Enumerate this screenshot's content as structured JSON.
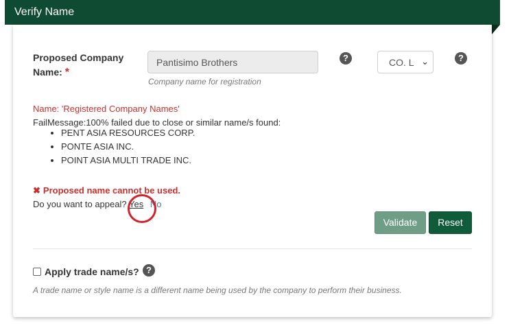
{
  "header": {
    "title": "Verify Name"
  },
  "form": {
    "label": "Proposed Company Name:",
    "required_mark": "*",
    "name_value": "Pantisimo Brothers",
    "name_hint": "Company name for registration",
    "help_glyph": "?",
    "suffix_value": "CO. L",
    "suffix_chevron": "⌄"
  },
  "result": {
    "name_source": "Name: 'Registered Company Names'",
    "fail_message": "FailMessage:100% failed due to close or similar name/s found:",
    "similar_names": [
      "PENT ASIA RESOURCES CORP.",
      "PONTE ASIA INC.",
      "POINT ASIA MULTI TRADE INC."
    ],
    "error_x": "✖",
    "error_text": "Proposed name cannot be used.",
    "appeal_question": "Do you want to appeal?",
    "appeal_yes": "Yes",
    "appeal_no": "No"
  },
  "actions": {
    "validate_label": "Validate",
    "reset_label": "Reset"
  },
  "trade": {
    "checkbox_label": "Apply trade name/s?",
    "note": "A trade name or style name is a different name being used by the company to perform their business."
  },
  "colors": {
    "header_bg": "#0f4a32",
    "error_red": "#c9302c",
    "validate_bg": "#6f9d86",
    "reset_bg": "#0f5b3a",
    "annotation_circle": "#d3232a"
  }
}
